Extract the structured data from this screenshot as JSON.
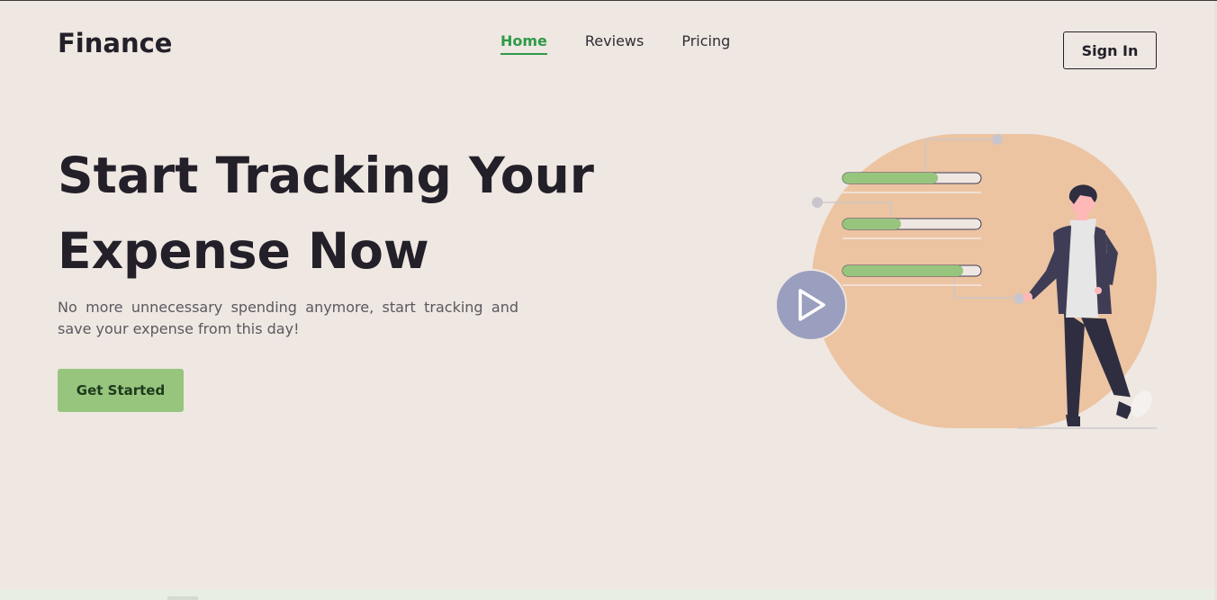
{
  "brand": {
    "name": "Finance"
  },
  "nav": {
    "items": [
      {
        "label": "Home",
        "active": true
      },
      {
        "label": "Reviews",
        "active": false
      },
      {
        "label": "Pricing",
        "active": false
      }
    ],
    "sign_in_label": "Sign In"
  },
  "hero": {
    "title_line1": "Start Tracking Your",
    "title_line2": "Expense Now",
    "subtitle": "No more unnecessary spending anymore, start tracking and save your expense from this day!",
    "cta_label": "Get Started"
  },
  "illustration": {
    "progress_bars": [
      0.69,
      0.42,
      0.87
    ],
    "play_icon": "play-icon",
    "colors": {
      "blob": "#ecc4a2",
      "bar_fill": "#97c57e",
      "play_button": "#9a9fbf",
      "person_jacket": "#3f3d56"
    }
  },
  "colors": {
    "background": "#efe7e1",
    "accent": "#2e9a48",
    "cta": "#97c57e",
    "text": "#23202a"
  }
}
